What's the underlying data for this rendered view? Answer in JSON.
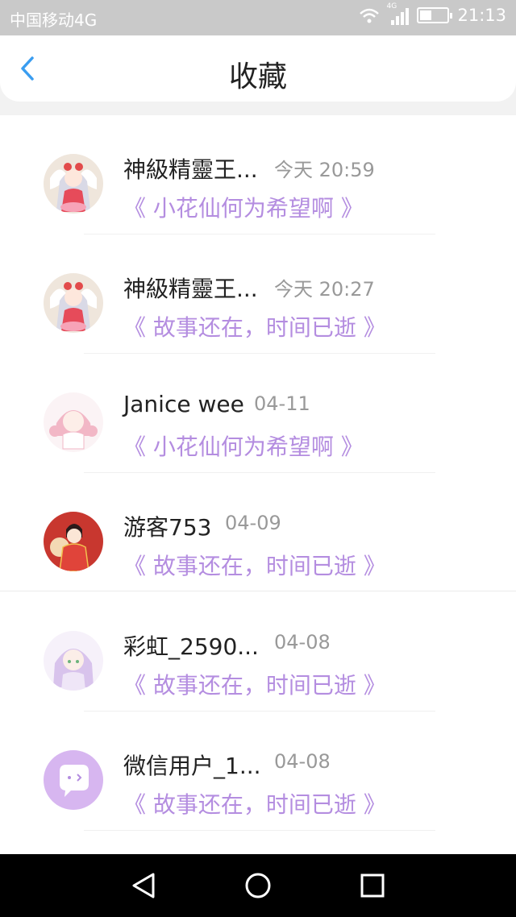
{
  "status_bar": {
    "carrier": "中国移动4G",
    "network_tag": "4G",
    "battery_level": 0.45,
    "time": "21:13"
  },
  "header": {
    "back_icon": "chevron-left-icon",
    "title": "收藏"
  },
  "colors": {
    "accent_blue": "#3a9df0",
    "story_purple": "#b48de0",
    "date_gray": "#999999"
  },
  "favorites": [
    {
      "name": "神級精靈王...",
      "date": "今天 20:59",
      "story": "《 小花仙何为希望啊 》",
      "avatar": "anime-angel-avatar"
    },
    {
      "name": "神級精靈王...",
      "date": "今天 20:27",
      "story": "《 故事还在，时间已逝 》",
      "avatar": "anime-angel-avatar"
    },
    {
      "name": "Janice wee",
      "date": "04-11",
      "story": "《 小花仙何为希望啊 》",
      "avatar": "anime-pink-girl-avatar"
    },
    {
      "name": "游客753",
      "date": "04-09",
      "story": "《 故事还在，时间已逝 》",
      "avatar": "anime-red-dress-avatar"
    },
    {
      "name": "彩虹_2590...",
      "date": "04-08",
      "story": "《 故事还在，时间已逝 》",
      "avatar": "anime-lilac-girl-avatar"
    },
    {
      "name": "微信用户_1...",
      "date": "04-08",
      "story": "《 故事还在，时间已逝 》",
      "avatar": "chat-bubble-avatar"
    }
  ],
  "nav_bar": {
    "back_icon": "triangle-back-icon",
    "home_icon": "circle-home-icon",
    "recents_icon": "square-recents-icon"
  }
}
